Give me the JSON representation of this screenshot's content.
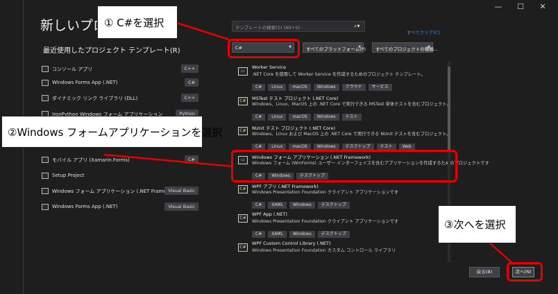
{
  "window_controls": {
    "minimize": "—",
    "maximize": "☐",
    "close": "✕"
  },
  "title": "新しいプロジ",
  "recent": {
    "heading": "最近使用したプロジェクト テンプレート(R)",
    "items": [
      {
        "label": "コンソール アプリ",
        "badge": "C++"
      },
      {
        "label": "Windows Forms App (.NET)",
        "badge": "C#"
      },
      {
        "label": "ダイナミック リンク ライブラリ (DLL)",
        "badge": "C++"
      },
      {
        "label": "IronPython Windows フォーム アプリケーション",
        "badge": "Python"
      },
      {
        "label": "モバイル アプリ (Xamarin.Forms)",
        "badge": "C#"
      },
      {
        "label": "Setup Project",
        "badge": ""
      },
      {
        "label": "Windows フォーム アプリケーション (.NET Framework)",
        "badge": "Visual Basic"
      },
      {
        "label": "Windows Forms App (.NET)",
        "badge": "Visual Basic"
      }
    ]
  },
  "search": {
    "placeholder": "テンプレートの検索(S) (Alt+S)"
  },
  "clear_all": "すべてクリア(C)",
  "filters": {
    "language": "C#",
    "platform": "すべてのプラットフォーム(P)",
    "project_type": "すべてのプロジェクトの種類..."
  },
  "templates": [
    {
      "name": "Worker Service",
      "desc": ".NET Core を使用して Worker Service を作成するためのプロジェクト テンプレート。",
      "tags": [
        "C#",
        "Linux",
        "macOS",
        "Windows",
        "クラウド",
        "サービス"
      ],
      "icon": "worker-icon"
    },
    {
      "name": "MSTest テスト プロジェクト (.NET Core)",
      "desc": "Windows、Linux、MacOS 上の .NET Core で実行できる MSTest 単体テストを含むプロジェクト。",
      "tags": [
        "C#",
        "Linux",
        "macOS",
        "Windows",
        "テスト"
      ],
      "icon": "test-icon"
    },
    {
      "name": "NUnit テスト プロジェクト (.NET Core)",
      "desc": "Windows、Linux および MacOS 上の .NET Core で実行できる NUnit テストを含むプロジェクト。",
      "tags": [
        "C#",
        "Linux",
        "macOS",
        "Windows",
        "デスクトップ",
        "テスト",
        "Web"
      ],
      "icon": "test-icon"
    },
    {
      "name": "Windows フォーム アプリケーション (.NET Framework)",
      "desc": "Windows フォーム (WinForms) ユーザー インターフェイスを含むアプリケーションを作成するためのプロジェクトです",
      "tags": [
        "C#",
        "Windows",
        "デスクトップ"
      ],
      "icon": "winforms-icon"
    },
    {
      "name": "WPF アプリ (.NET Framework)",
      "desc": "Windows Presentation Foundation クライアント アプリケーションです",
      "tags": [
        "C#",
        "XAML",
        "Windows",
        "デスクトップ"
      ],
      "icon": "wpf-icon"
    },
    {
      "name": "WPF App (.NET)",
      "desc": "Windows Presentation Foundation クライアント アプリケーションです",
      "tags": [
        "C#",
        "XAML",
        "Windows",
        "デスクトップ"
      ],
      "icon": "wpf-icon"
    },
    {
      "name": "WPF Custom Control Library (.NET)",
      "desc": "Windows Presentation Foundation カスタム コントロール ライブラリ",
      "tags": [],
      "icon": "wpf-library-icon"
    }
  ],
  "buttons": {
    "back": "戻る(B)",
    "next": "次へ(N)"
  },
  "annotations": {
    "step1": "① C#を選択",
    "step2": "②Windows フォームアプリケーションを選択",
    "step3": "③次へを選択"
  },
  "colors": {
    "annotation_red": "#e60000",
    "link_blue": "#3794ff",
    "background": "#1e1e1e",
    "tag_bg": "#3f3f46"
  }
}
